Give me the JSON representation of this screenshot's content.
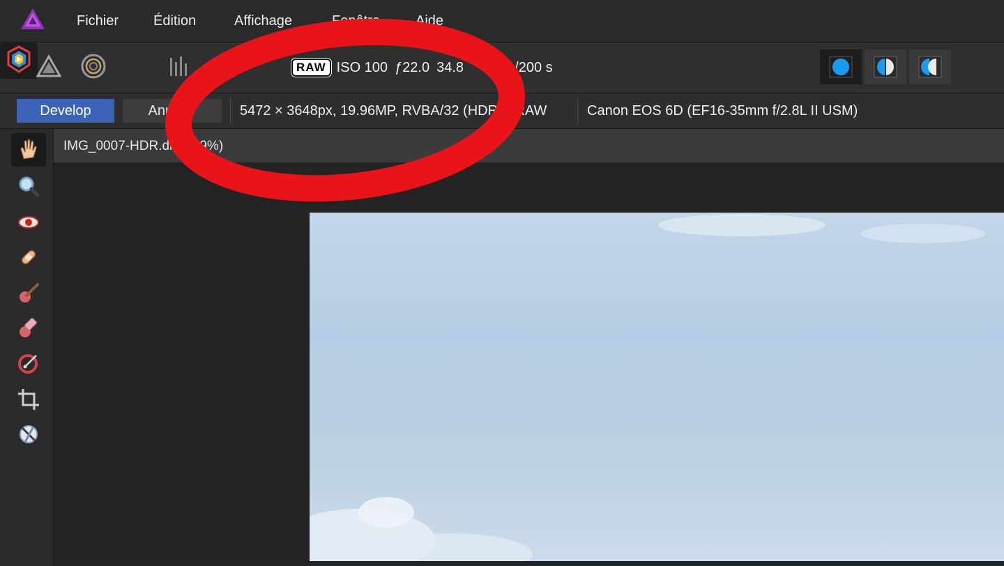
{
  "menu": {
    "items": [
      "Fichier",
      "Édition",
      "Affichage",
      "Fenêtre",
      "Aide"
    ]
  },
  "toolbar": {
    "personas": [
      "photo-persona-icon",
      "liquify-persona-icon",
      "develop-persona-icon",
      "tone-mapping-persona-icon",
      "export-persona-icon"
    ],
    "exif": {
      "raw_label": "RAW",
      "iso": "ISO 100",
      "aperture": "ƒ22.0",
      "focal": "34.8",
      "shutter": "1/200 s"
    },
    "view_modes": [
      "single-view-icon",
      "split-view-icon",
      "mirror-view-icon"
    ]
  },
  "context": {
    "develop_label": "Develop",
    "cancel_label": "Annuler",
    "image_info": "5472 × 3648px, 19.96MP, RVBA/32 (HDR) - RAW",
    "camera_info": "Canon EOS 6D (EF16-35mm f/2.8L II USM)"
  },
  "tools": [
    "hand-icon",
    "zoom-icon",
    "red-eye-icon",
    "blemish-icon",
    "overlay-paint-icon",
    "overlay-erase-icon",
    "overlay-gradient-icon",
    "crop-icon",
    "white-balance-picker-icon"
  ],
  "document": {
    "tab_title": "IMG_0007-HDR.dng (19%)"
  },
  "colors": {
    "accent": "#3a63b8",
    "annotation": "#e8141a"
  }
}
